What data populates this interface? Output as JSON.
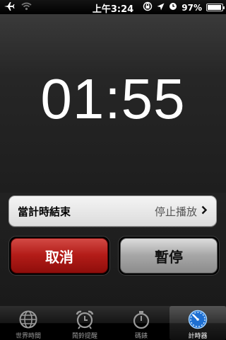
{
  "status_bar": {
    "time": "上午3:24",
    "battery_percent": "97%",
    "battery_level": 0.97,
    "icons": [
      "airplane-icon",
      "wifi-icon",
      "orientation-lock-icon",
      "location-icon",
      "alarm-icon",
      "battery-icon"
    ]
  },
  "timer": {
    "display": "01:55"
  },
  "when_timer_ends": {
    "label": "當計時結束",
    "value": "停止播放"
  },
  "buttons": {
    "cancel_label": "取消",
    "pause_label": "暫停"
  },
  "tabs": [
    {
      "label": "世界時間",
      "icon": "globe-icon",
      "active": false
    },
    {
      "label": "鬧鈴提醒",
      "icon": "alarm-clock-icon",
      "active": false
    },
    {
      "label": "碼錶",
      "icon": "stopwatch-icon",
      "active": false
    },
    {
      "label": "計時器",
      "icon": "timer-icon",
      "active": true
    }
  ],
  "colors": {
    "cancel": "#b31c18",
    "pause": "#a7a7a7",
    "active_tab_icon": "#4aa3ff"
  }
}
